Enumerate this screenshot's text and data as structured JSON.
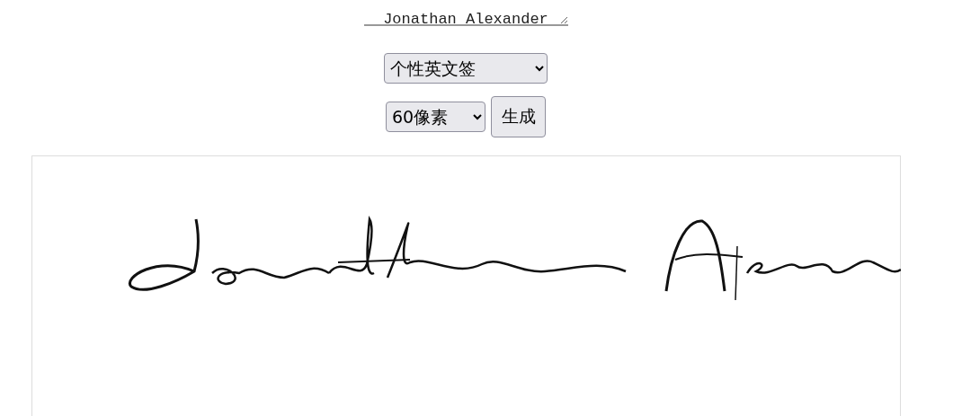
{
  "name_input": {
    "value": "Jonathan Alexander"
  },
  "style_select": {
    "value": "个性英文签"
  },
  "size_select": {
    "value": "60像素"
  },
  "generate_button": {
    "label": "生成"
  }
}
